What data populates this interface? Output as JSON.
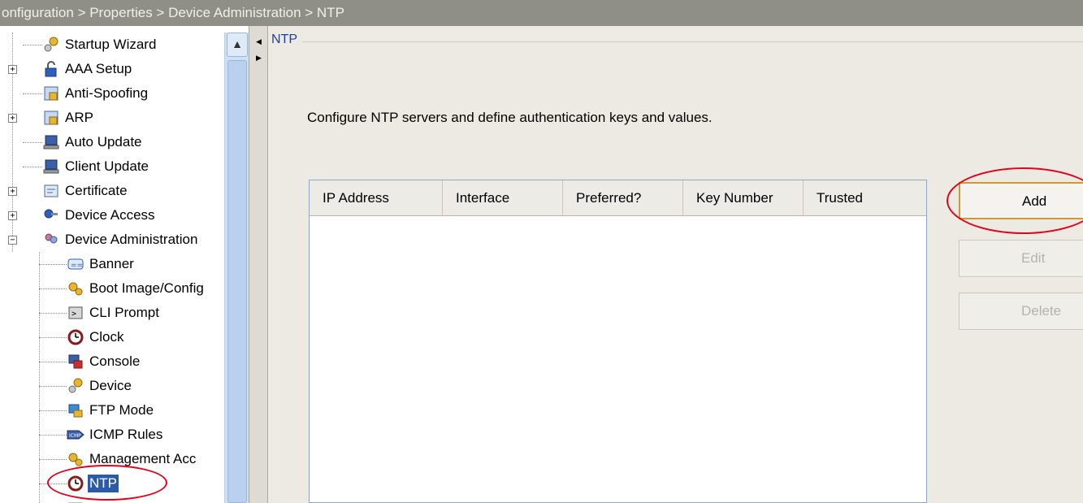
{
  "breadcrumb": "onfiguration > Properties > Device Administration > NTP",
  "sidebar": {
    "items": [
      {
        "label": "Startup Wizard",
        "icon": "wizard-icon"
      },
      {
        "label": "AAA Setup",
        "icon": "lock-icon"
      },
      {
        "label": "Anti-Spoofing",
        "icon": "shield-config-icon"
      },
      {
        "label": "ARP",
        "icon": "arp-icon"
      },
      {
        "label": "Auto Update",
        "icon": "computer-icon"
      },
      {
        "label": "Client Update",
        "icon": "computer-icon"
      },
      {
        "label": "Certificate",
        "icon": "certificate-icon"
      },
      {
        "label": "Device Access",
        "icon": "key-icon"
      },
      {
        "label": "Device Administration",
        "icon": "users-icon"
      },
      {
        "label": "Banner",
        "icon": "banner-icon"
      },
      {
        "label": "Boot Image/Config",
        "icon": "gears-icon"
      },
      {
        "label": "CLI Prompt",
        "icon": "terminal-icon"
      },
      {
        "label": "Clock",
        "icon": "clock-icon"
      },
      {
        "label": "Console",
        "icon": "console-icon"
      },
      {
        "label": "Device",
        "icon": "wizard-icon"
      },
      {
        "label": "FTP Mode",
        "icon": "ftp-icon"
      },
      {
        "label": "ICMP Rules",
        "icon": "icmp-icon"
      },
      {
        "label": "Management Acc",
        "icon": "gears-icon"
      },
      {
        "label": "NTP",
        "icon": "clock-icon"
      }
    ]
  },
  "panel": {
    "title": "NTP",
    "description": "Configure NTP servers and define authentication keys and values."
  },
  "table": {
    "columns": [
      "IP Address",
      "Interface",
      "Preferred?",
      "Key Number",
      "Trusted"
    ],
    "rows": []
  },
  "buttons": {
    "add": "Add",
    "edit": "Edit",
    "delete": "Delete"
  },
  "colors": {
    "highlight": "#e3001b",
    "selection": "#2b5ba8",
    "title": "#1e3fa8"
  }
}
